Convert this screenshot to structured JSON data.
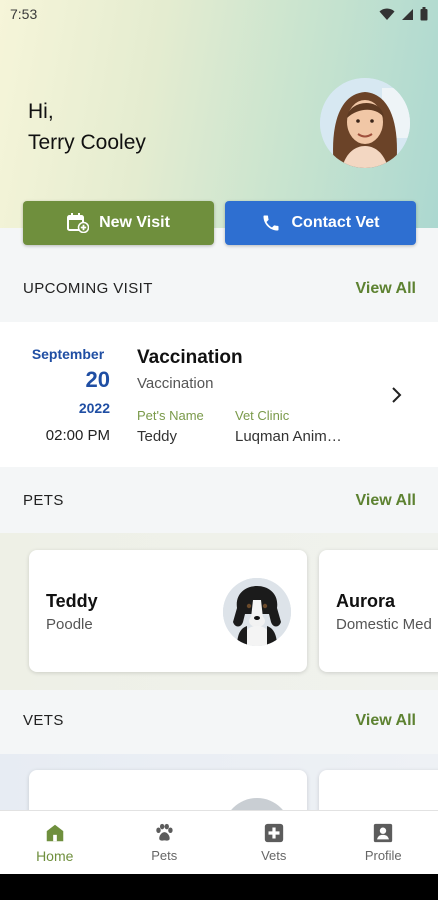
{
  "status": {
    "time": "7:53"
  },
  "greeting": {
    "line1": "Hi,",
    "line2": "Terry Cooley"
  },
  "actions": {
    "new_visit": "New Visit",
    "contact_vet": "Contact Vet"
  },
  "upcoming": {
    "title": "UPCOMING VISIT",
    "view_all": "View All",
    "visit": {
      "month": "September",
      "day": "20",
      "year": "2022",
      "time": "02:00 PM",
      "title": "Vaccination",
      "subtitle": "Vaccination",
      "pet_label": "Pet's Name",
      "pet_value": "Teddy",
      "clinic_label": "Vet Clinic",
      "clinic_value": "Luqman Anim…"
    }
  },
  "pets": {
    "title": "PETS",
    "view_all": "View All",
    "items": [
      {
        "name": "Teddy",
        "breed": "Poodle"
      },
      {
        "name": "Aurora",
        "breed": "Domestic Med"
      }
    ]
  },
  "vets": {
    "title": "VETS",
    "view_all": "View All"
  },
  "nav": [
    {
      "label": "Home",
      "icon": "home-icon",
      "active": true
    },
    {
      "label": "Pets",
      "icon": "paw-icon"
    },
    {
      "label": "Vets",
      "icon": "medical-cross-icon"
    },
    {
      "label": "Profile",
      "icon": "profile-badge-icon"
    }
  ],
  "colors": {
    "accent_green": "#6f8f3d",
    "accent_blue": "#2e6fd1",
    "date_blue": "#1f4ea3"
  }
}
